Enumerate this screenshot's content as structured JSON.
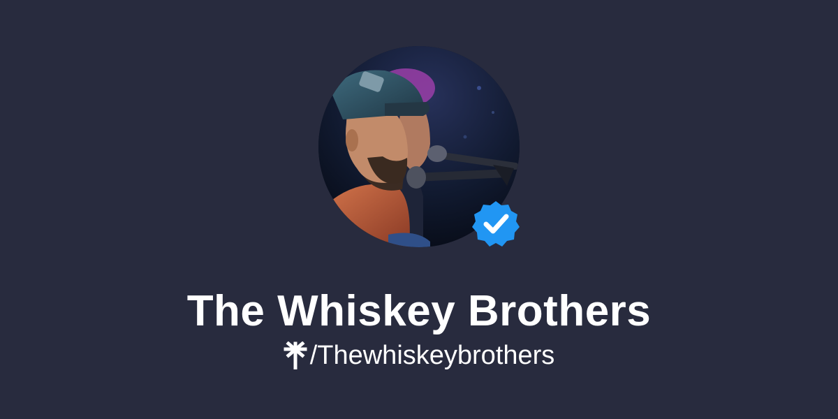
{
  "profile": {
    "name": "The Whiskey Brothers",
    "handle": "/Thewhiskeybrothers",
    "verified": true,
    "avatar_alt": "Profile photo",
    "icons": {
      "verified": "verified-check-icon",
      "brand": "linktree-logo-icon"
    }
  },
  "colors": {
    "background": "#282b3e",
    "text": "#ffffff",
    "verified_badge": "#2196f3"
  }
}
